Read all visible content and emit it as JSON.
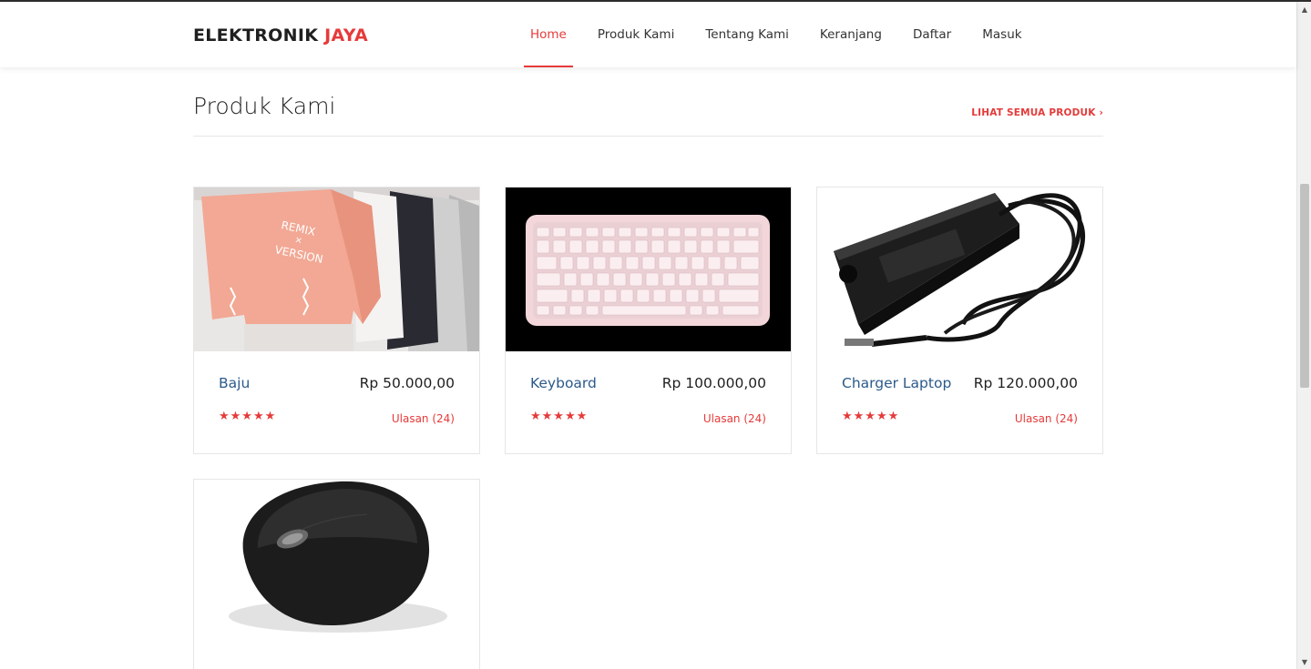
{
  "brand": {
    "name_main": "ELEKTRONIK",
    "name_accent": "JAYA",
    "accent_color": "#e63a3a"
  },
  "nav": {
    "items": [
      {
        "label": "Home",
        "active": true
      },
      {
        "label": "Produk Kami",
        "active": false
      },
      {
        "label": "Tentang Kami",
        "active": false
      },
      {
        "label": "Keranjang",
        "active": false
      },
      {
        "label": "Daftar",
        "active": false
      },
      {
        "label": "Masuk",
        "active": false
      }
    ]
  },
  "section": {
    "title": "Produk Kami",
    "see_all": "LIHAT SEMUA PRODUK",
    "see_all_icon": "chevron-right-icon"
  },
  "products": [
    {
      "name": "Baju",
      "price": "Rp 50.000,00",
      "rating": 5,
      "stars": "★★★★★",
      "reviews": "Ulasan (24)",
      "image": "shirts-photo"
    },
    {
      "name": "Keyboard",
      "price": "Rp 100.000,00",
      "rating": 5,
      "stars": "★★★★★",
      "reviews": "Ulasan (24)",
      "image": "pink-keyboard-photo"
    },
    {
      "name": "Charger Laptop",
      "price": "Rp 120.000,00",
      "rating": 5,
      "stars": "★★★★★",
      "reviews": "Ulasan (24)",
      "image": "laptop-charger-photo"
    },
    {
      "image": "mouse-photo"
    }
  ]
}
